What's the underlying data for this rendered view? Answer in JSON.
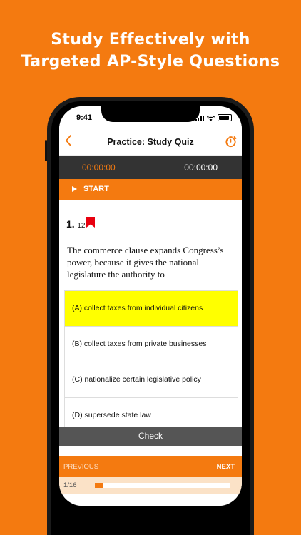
{
  "headline": {
    "line1": "Study Effectively with",
    "line2": "Targeted AP-Style Questions"
  },
  "status_bar": {
    "time": "9:41"
  },
  "nav": {
    "back_icon": "chevron-left-icon",
    "title": "Practice: Study Quiz",
    "timer_icon": "stopwatch-icon"
  },
  "timer": {
    "question_time": "00:00:00",
    "total_time": "00:00:00"
  },
  "start": {
    "label": "START"
  },
  "question": {
    "number": "1.",
    "id": "12",
    "text": "The commerce clause expands Congress’s power, because it gives the national legislature the authority to"
  },
  "choices": [
    {
      "label": "(A) collect taxes from individual citizens",
      "selected": true
    },
    {
      "label": "(B) collect taxes from private businesses",
      "selected": false
    },
    {
      "label": "(C) nationalize certain legislative policy",
      "selected": false
    },
    {
      "label": "(D) supersede state law",
      "selected": false
    }
  ],
  "check_label": "Check",
  "pager": {
    "previous": "PREVIOUS",
    "next": "NEXT"
  },
  "progress": {
    "label": "1/16",
    "current": 1,
    "total": 16
  },
  "colors": {
    "accent": "#f47a10",
    "selected": "#ffff00",
    "dark": "#333333"
  }
}
